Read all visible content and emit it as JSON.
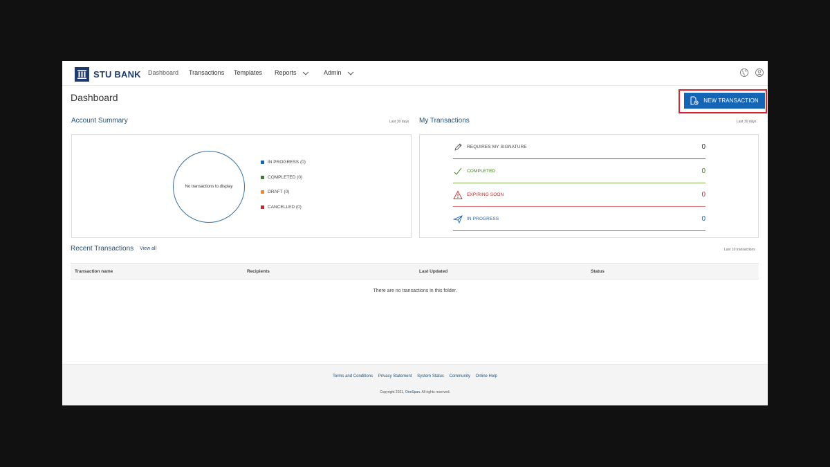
{
  "brand": {
    "name": "STU BANK"
  },
  "nav": {
    "items": [
      {
        "label": "Dashboard"
      },
      {
        "label": "Transactions"
      },
      {
        "label": "Templates"
      },
      {
        "label": "Reports"
      },
      {
        "label": "Admin"
      }
    ],
    "icons": [
      "globe-icon",
      "user-icon"
    ]
  },
  "page": {
    "title": "Dashboard"
  },
  "actions": {
    "new_transaction": "NEW TRANSACTION"
  },
  "account_summary": {
    "title": "Account Summary",
    "period": "Last 30 days",
    "empty_chart": "No transactions to display",
    "legend": [
      {
        "label": "IN PROGRESS (0)",
        "color": "#1565b7"
      },
      {
        "label": "COMPLETED (0)",
        "color": "#3a7d2a"
      },
      {
        "label": "DRAFT (0)",
        "color": "#ef8a24"
      },
      {
        "label": "CANCELLED (0)",
        "color": "#c8262b"
      }
    ]
  },
  "my_transactions": {
    "title": "My Transactions",
    "period": "Last 30 days",
    "rows": [
      {
        "label": "REQUIRES MY SIGNATURE",
        "count": "0",
        "color": "#444444",
        "icon": "pen-icon"
      },
      {
        "label": "COMPLETED",
        "count": "0",
        "color": "#3f7f20",
        "icon": "check-icon"
      },
      {
        "label": "EXPIRING SOON",
        "count": "0",
        "color": "#c8262b",
        "icon": "warning-icon"
      },
      {
        "label": "IN PROGRESS",
        "count": "0",
        "color": "#1565b7",
        "icon": "send-icon"
      }
    ]
  },
  "recent_transactions": {
    "title": "Recent Transactions",
    "view_all": "View all",
    "meta": "Last 10 transactions",
    "columns": [
      "Transaction name",
      "Recipients",
      "Last Updated",
      "Status"
    ],
    "empty": "There are no transactions in this folder."
  },
  "footer": {
    "links": [
      "Terms and Conditions",
      "Privacy Statement",
      "System Status",
      "Community",
      "Online Help"
    ],
    "copyright_prefix": "Copyright 2021,",
    "copyright_brand": "OneSpan",
    "copyright_suffix": ". All rights reserved."
  }
}
